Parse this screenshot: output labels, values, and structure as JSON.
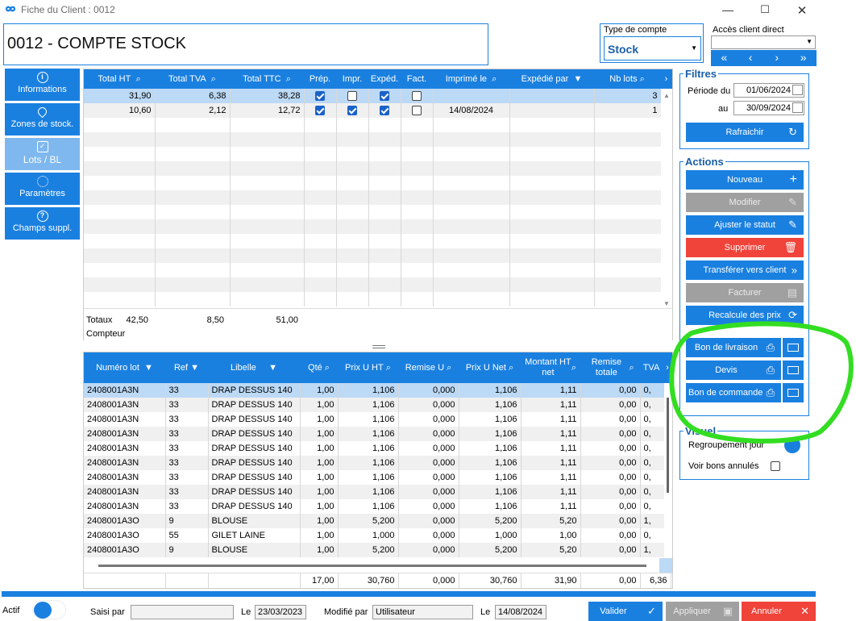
{
  "window": {
    "title": "Fiche du Client : 0012"
  },
  "header": {
    "code_title": "0012 - COMPTE STOCK",
    "type_compte_label": "Type de compte",
    "type_compte_value": "Stock",
    "acces_label": "Accès client direct",
    "nav": [
      "«",
      "‹",
      "›",
      "»"
    ]
  },
  "sidebar": {
    "items": [
      {
        "label": "Informations",
        "icon": "info-icon"
      },
      {
        "label": "Zones de stock.",
        "icon": "location-pin-icon"
      },
      {
        "label": "Lots / BL",
        "icon": "clipboard-icon"
      },
      {
        "label": "Paramètres",
        "icon": "gear-icon"
      },
      {
        "label": "Champs suppl.",
        "icon": "question-icon"
      }
    ]
  },
  "lots_table": {
    "columns": [
      "Total HT",
      "Total TVA",
      "Total TTC",
      "Prép.",
      "Impr.",
      "Expéd.",
      "Fact.",
      "Imprimé le",
      "Expédié par",
      "Nb lots"
    ],
    "rows": [
      {
        "total_ht": "31,90",
        "total_tva": "6,38",
        "total_ttc": "38,28",
        "prep": true,
        "impr": false,
        "exped": true,
        "fact": false,
        "imprime_le": "",
        "expedie_par": "",
        "nb_lots": "3"
      },
      {
        "total_ht": "10,60",
        "total_tva": "2,12",
        "total_ttc": "12,72",
        "prep": true,
        "impr": true,
        "exped": true,
        "fact": false,
        "imprime_le": "14/08/2024",
        "expedie_par": "",
        "nb_lots": "1"
      }
    ],
    "totaux_label": "Totaux",
    "totaux": [
      "42,50",
      "8,50",
      "51,00"
    ],
    "compteur_label": "Compteur"
  },
  "detail_table": {
    "columns": [
      "Numéro lot",
      "Ref",
      "Libelle",
      "Qté",
      "Prix U HT",
      "Remise U",
      "Prix U Net",
      "Montant HT net",
      "Remise totale",
      "TVA"
    ],
    "rows": [
      [
        "2408001A3N",
        "33",
        "DRAP DESSUS 140",
        "1,00",
        "1,106",
        "0,000",
        "1,106",
        "1,11",
        "0,00",
        "0,"
      ],
      [
        "2408001A3N",
        "33",
        "DRAP DESSUS 140",
        "1,00",
        "1,106",
        "0,000",
        "1,106",
        "1,11",
        "0,00",
        "0,"
      ],
      [
        "2408001A3N",
        "33",
        "DRAP DESSUS 140",
        "1,00",
        "1,106",
        "0,000",
        "1,106",
        "1,11",
        "0,00",
        "0,"
      ],
      [
        "2408001A3N",
        "33",
        "DRAP DESSUS 140",
        "1,00",
        "1,106",
        "0,000",
        "1,106",
        "1,11",
        "0,00",
        "0,"
      ],
      [
        "2408001A3N",
        "33",
        "DRAP DESSUS 140",
        "1,00",
        "1,106",
        "0,000",
        "1,106",
        "1,11",
        "0,00",
        "0,"
      ],
      [
        "2408001A3N",
        "33",
        "DRAP DESSUS 140",
        "1,00",
        "1,106",
        "0,000",
        "1,106",
        "1,11",
        "0,00",
        "0,"
      ],
      [
        "2408001A3N",
        "33",
        "DRAP DESSUS 140",
        "1,00",
        "1,106",
        "0,000",
        "1,106",
        "1,11",
        "0,00",
        "0,"
      ],
      [
        "2408001A3N",
        "33",
        "DRAP DESSUS 140",
        "1,00",
        "1,106",
        "0,000",
        "1,106",
        "1,11",
        "0,00",
        "0,"
      ],
      [
        "2408001A3N",
        "33",
        "DRAP DESSUS 140",
        "1,00",
        "1,106",
        "0,000",
        "1,106",
        "1,11",
        "0,00",
        "0,"
      ],
      [
        "2408001A3O",
        "9",
        "BLOUSE",
        "1,00",
        "5,200",
        "0,000",
        "5,200",
        "5,20",
        "0,00",
        "1,"
      ],
      [
        "2408001A3O",
        "55",
        "GILET LAINE",
        "1,00",
        "1,000",
        "0,000",
        "1,000",
        "1,00",
        "0,00",
        "0,"
      ],
      [
        "2408001A3O",
        "9",
        "BLOUSE",
        "1,00",
        "5,200",
        "0,000",
        "5,200",
        "5,20",
        "0,00",
        "1,"
      ]
    ],
    "totals": [
      "",
      "",
      "",
      "17,00",
      "30,760",
      "0,000",
      "30,760",
      "31,90",
      "0,00",
      "6,36"
    ]
  },
  "filtres": {
    "title": "Filtres",
    "periode_du_label": "Période du",
    "periode_du": "01/06/2024",
    "au_label": "au",
    "au": "30/09/2024",
    "refresh": "Rafraichir"
  },
  "actions": {
    "title": "Actions",
    "nouveau": "Nouveau",
    "modifier": "Modifier",
    "ajuster": "Ajuster le statut",
    "supprimer": "Supprimer",
    "transferer": "Transférer vers client",
    "facturer": "Facturer",
    "recalcule": "Recalcule des prix",
    "bon_livraison": "Bon de livraison",
    "devis": "Devis",
    "bon_commande": "Bon de commande"
  },
  "visuel": {
    "title": "Visuel",
    "regroupement": "Regroupement jour",
    "voir_annules": "Voir bons annulés"
  },
  "footer": {
    "actif": "Actif",
    "saisi_par": "Saisi par",
    "saisi_par_value": "",
    "le1": "Le",
    "date_saisie": "23/03/2023",
    "modifie_par": "Modifié par",
    "modifie_par_value": "Utilisateur",
    "le2": "Le",
    "date_modif": "14/08/2024",
    "valider": "Valider",
    "appliquer": "Appliquer",
    "annuler": "Annuler"
  },
  "colors": {
    "accent": "#1a80e0",
    "danger": "#f0433a",
    "disabled": "#a0a0a0",
    "highlight": "#33dd22"
  }
}
